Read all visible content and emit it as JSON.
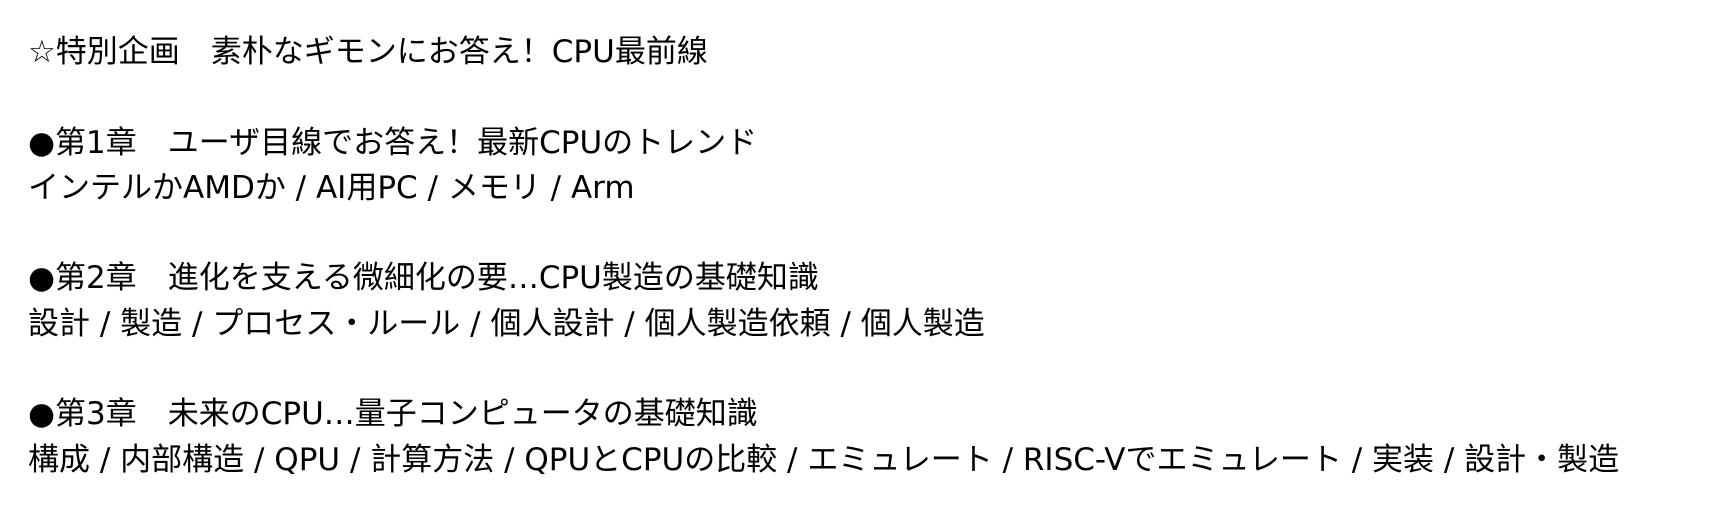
{
  "feature": {
    "title": "☆特別企画　素朴なギモンにお答え！CPU最前線"
  },
  "chapters": [
    {
      "heading": "●第1章　ユーザ目線でお答え！最新CPUのトレンド",
      "topics": "インテルかAMDか / AI用PC / メモリ / Arm"
    },
    {
      "heading": "●第2章　進化を支える微細化の要…CPU製造の基礎知識",
      "topics": "設計 / 製造 / プロセス・ルール / 個人設計 / 個人製造依頼 / 個人製造"
    },
    {
      "heading": "●第3章　未来のCPU…量子コンピュータの基礎知識",
      "topics": "構成 / 内部構造 / QPU / 計算方法 / QPUとCPUの比較 / エミュレート / RISC-Vでエミュレート / 実装 / 設計・製造"
    }
  ]
}
